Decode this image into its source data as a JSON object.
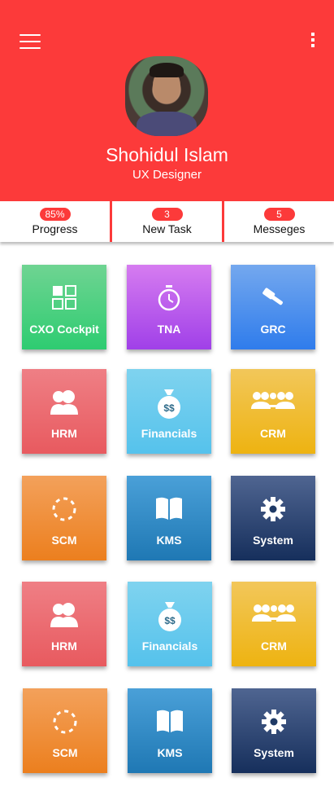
{
  "profile": {
    "name": "Shohidul Islam",
    "role": "UX Designer"
  },
  "stats": [
    {
      "badge": "85%",
      "label": "Progress"
    },
    {
      "badge": "3",
      "label": "New Task"
    },
    {
      "badge": "5",
      "label": "Messeges"
    }
  ],
  "tiles": [
    {
      "label": "CXO Cockpit",
      "icon": "grid-icon",
      "color": "#2ecc71"
    },
    {
      "label": "TNA",
      "icon": "stopwatch-icon",
      "color": "#a040e8"
    },
    {
      "label": "GRC",
      "icon": "gavel-icon",
      "color": "#2f7cec"
    },
    {
      "label": "HRM",
      "icon": "users-icon",
      "color": "#e85a5f"
    },
    {
      "label": "Financials",
      "icon": "money-bag-icon",
      "color": "#55c2ec"
    },
    {
      "label": "CRM",
      "icon": "handshake-icon",
      "color": "#eeb311"
    },
    {
      "label": "SCM",
      "icon": "loading-circle-icon",
      "color": "#ec7f1e"
    },
    {
      "label": "KMS",
      "icon": "book-icon",
      "color": "#1f78b4"
    },
    {
      "label": "System",
      "icon": "gear-icon",
      "color": "#162f5c"
    },
    {
      "label": "HRM",
      "icon": "users-icon",
      "color": "#e85a5f"
    },
    {
      "label": "Financials",
      "icon": "money-bag-icon",
      "color": "#55c2ec"
    },
    {
      "label": "CRM",
      "icon": "handshake-icon",
      "color": "#eeb311"
    },
    {
      "label": "SCM",
      "icon": "loading-circle-icon",
      "color": "#ec7f1e"
    },
    {
      "label": "KMS",
      "icon": "book-icon",
      "color": "#1f78b4"
    },
    {
      "label": "System",
      "icon": "gear-icon",
      "color": "#162f5c"
    }
  ],
  "theme": {
    "header": "#fc3a3a",
    "badge": "#fc3a3a"
  }
}
